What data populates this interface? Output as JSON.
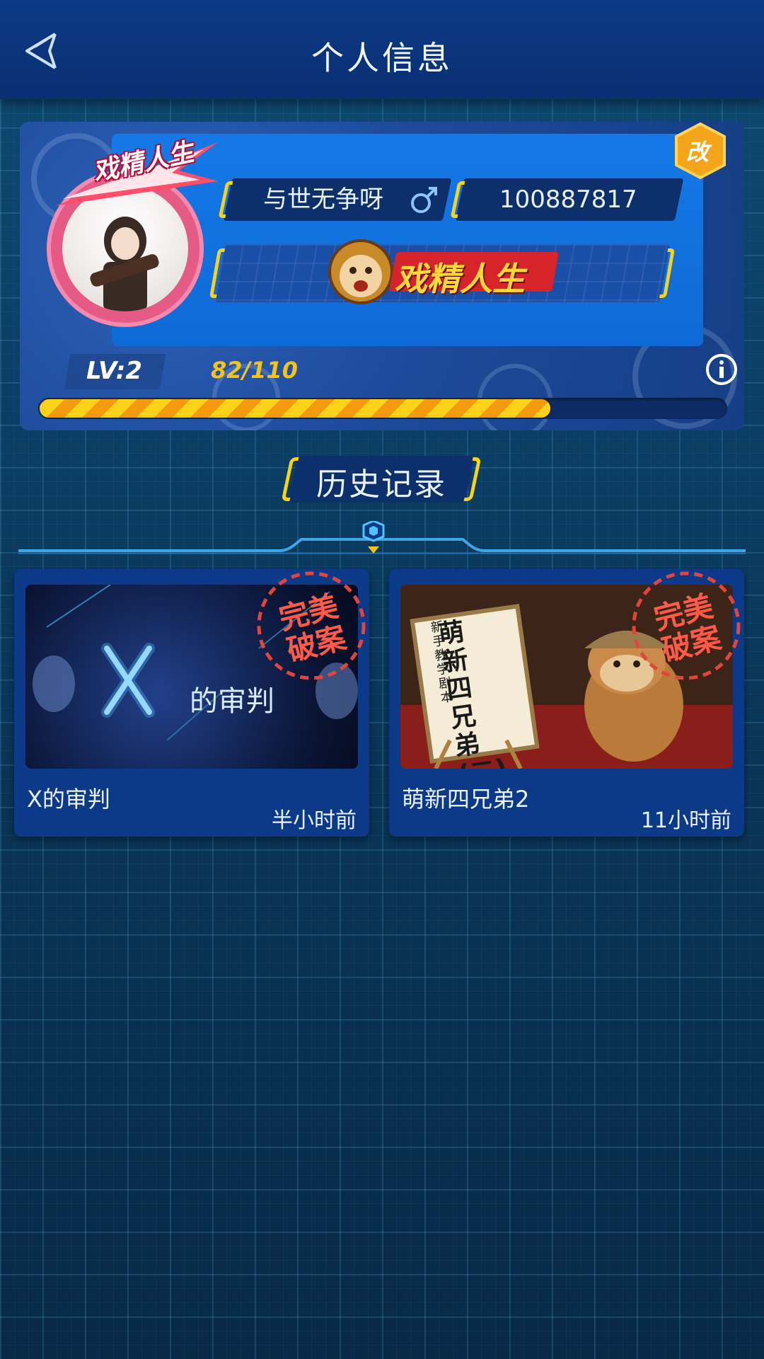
{
  "header": {
    "title": "个人信息"
  },
  "profile": {
    "nickname": "与世无争呀",
    "gender_symbol": "♂",
    "user_id": "100887817",
    "title_badge": "戏精人生",
    "avatar_badge": "戏精人生",
    "edit_label": "改",
    "level": "LV:2",
    "exp": "82/110",
    "progress_fraction": 0.745
  },
  "history": {
    "title": "历史记录",
    "cards": [
      {
        "title": "X的审判",
        "time": "半小时前",
        "stamp": "完美破案",
        "thumb_text": "的审判"
      },
      {
        "title": "萌新四兄弟2",
        "time": "11小时前",
        "stamp": "完美破案",
        "thumb_sign_main": "萌新四兄弟(二)",
        "thumb_sign_sub": "新手教学剧本"
      }
    ]
  },
  "colors": {
    "accent": "#f5d21f",
    "header": "#0d3a86",
    "card": "#0d3a88",
    "stamp": "#e2453d"
  },
  "icons": {
    "back": "back-arrow-icon",
    "gender": "male-icon",
    "info": "info-icon",
    "edit": "edit-icon"
  }
}
